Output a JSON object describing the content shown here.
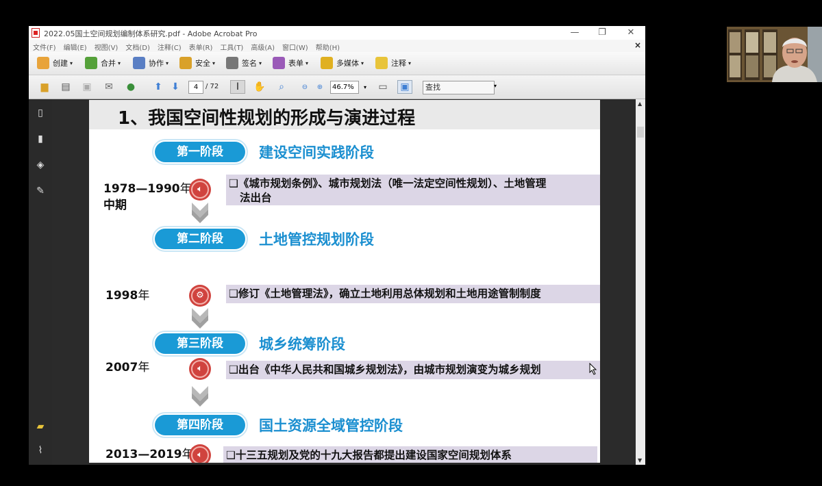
{
  "window": {
    "title": "2022.05国土空间规划编制体系研究.pdf - Adobe Acrobat Pro",
    "controls": {
      "minimize": "—",
      "maximize": "❐",
      "close": "✕"
    }
  },
  "menu": [
    "文件(F)",
    "编辑(E)",
    "视图(V)",
    "文档(D)",
    "注释(C)",
    "表单(R)",
    "工具(T)",
    "高级(A)",
    "窗口(W)",
    "帮助(H)"
  ],
  "menu_close": "×",
  "toolbar1": {
    "create": "创建",
    "combine": "合并",
    "collaborate": "协作",
    "secure": "安全",
    "sign": "签名",
    "forms": "表单",
    "multimedia": "多媒体",
    "comment": "注释"
  },
  "toolbar2": {
    "page_current": "4",
    "page_total": "/ 72",
    "zoom": "46.7%",
    "search_placeholder": "查找"
  },
  "slide": {
    "title": "1、我国空间性规划的形成与演进过程",
    "stages": [
      {
        "pill": "第一阶段",
        "name": "建设空间实践阶段",
        "year_bold": "1978—1990",
        "year_suffix": "年",
        "year_line2": "中期",
        "text_line1": "❑《城市规划条例》、城市规划法（唯一法定空间性规划）、土地管理",
        "text_line2": "法出台",
        "icon": "speaker-icon"
      },
      {
        "pill": "第二阶段",
        "name": "土地管控规划阶段",
        "year_bold": "1998",
        "year_suffix": "年",
        "text_line1": "❑修订《土地管理法》，确立土地利用总体规划和土地用途管制制度",
        "icon": "gear-icon"
      },
      {
        "pill": "第三阶段",
        "name": "城乡统筹阶段",
        "year_bold": "2007",
        "year_suffix": "年",
        "text_line1": "❑出台《中华人民共和国城乡规划法》，由城市规划演变为城乡规划",
        "icon": "speaker-icon"
      },
      {
        "pill": "第四阶段",
        "name": "国土资源全域管控阶段",
        "year_bold": "2013—2019",
        "year_suffix": "年",
        "text_line1": "❑十三五规划及党的十九大报告都提出建设国家空间规划体系",
        "icon": "speaker-icon"
      }
    ]
  },
  "colors": {
    "pill": "#1a9ad6",
    "stage_text": "#1b8fd0",
    "circle": "#d0433e",
    "box": "#dcd6e6"
  }
}
